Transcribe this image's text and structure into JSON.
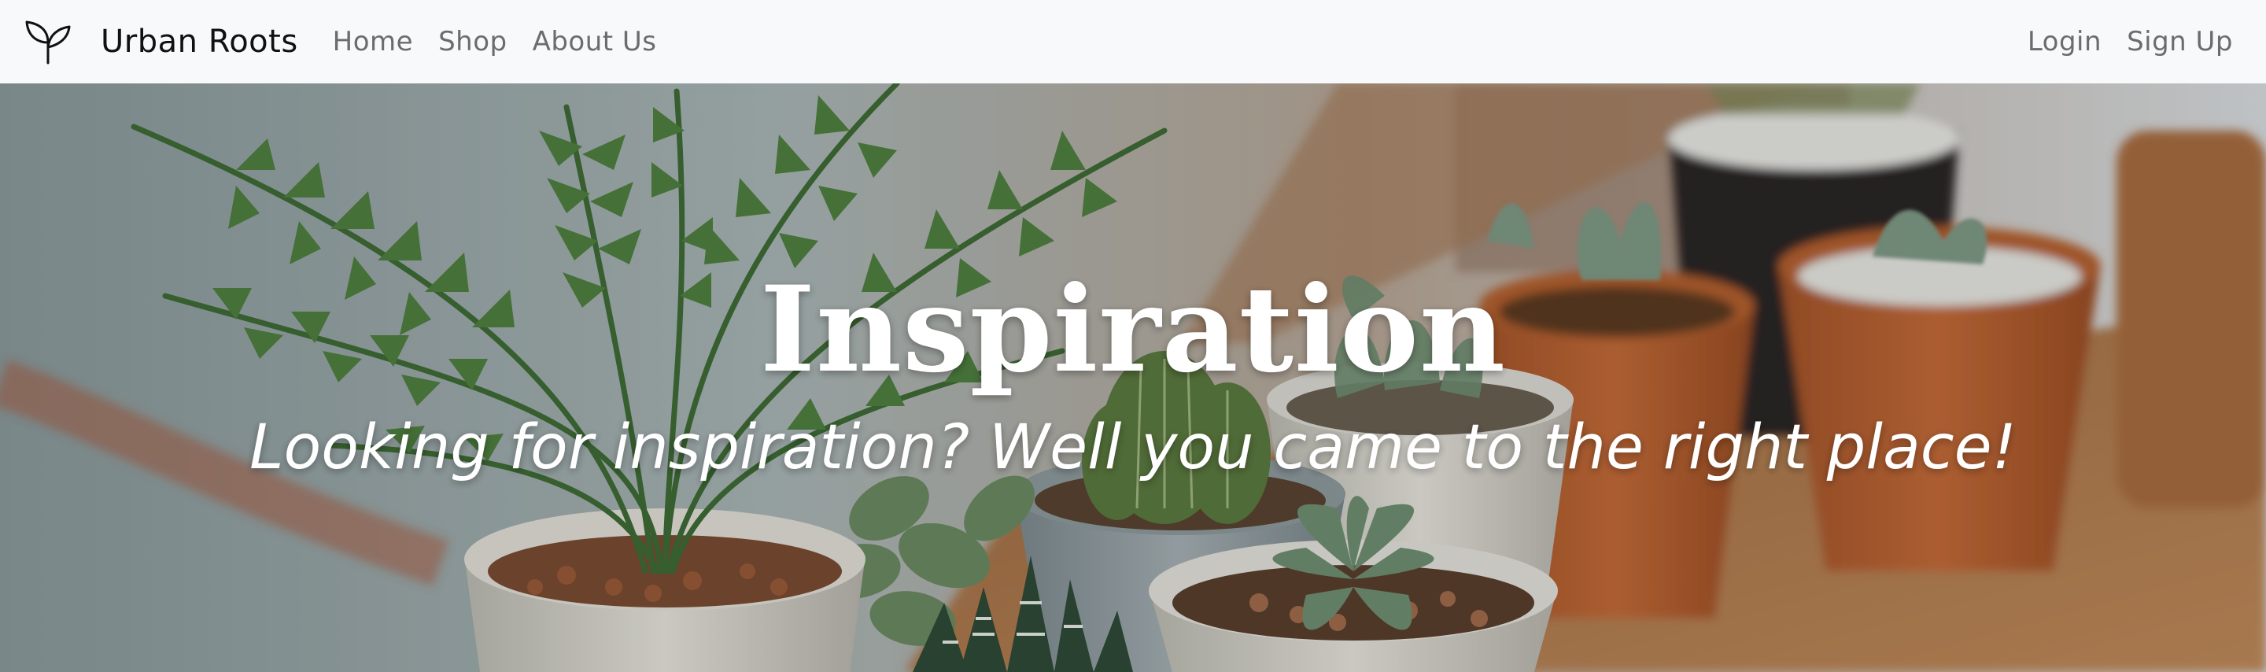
{
  "navbar": {
    "brand_icon": "sprout-icon",
    "brand_name": "Urban Roots",
    "left_links": [
      "Home",
      "Shop",
      "About Us"
    ],
    "right_links": [
      "Login",
      "Sign Up"
    ]
  },
  "hero": {
    "title": "Inspiration",
    "subtitle": "Looking for inspiration? Well you came to the right place!",
    "background_image": "potted-plants-photo"
  },
  "colors": {
    "navbar_bg": "#f8f9fa",
    "nav_link": "#6c6c6c",
    "brand_text": "#111111",
    "hero_text": "#ffffff"
  }
}
